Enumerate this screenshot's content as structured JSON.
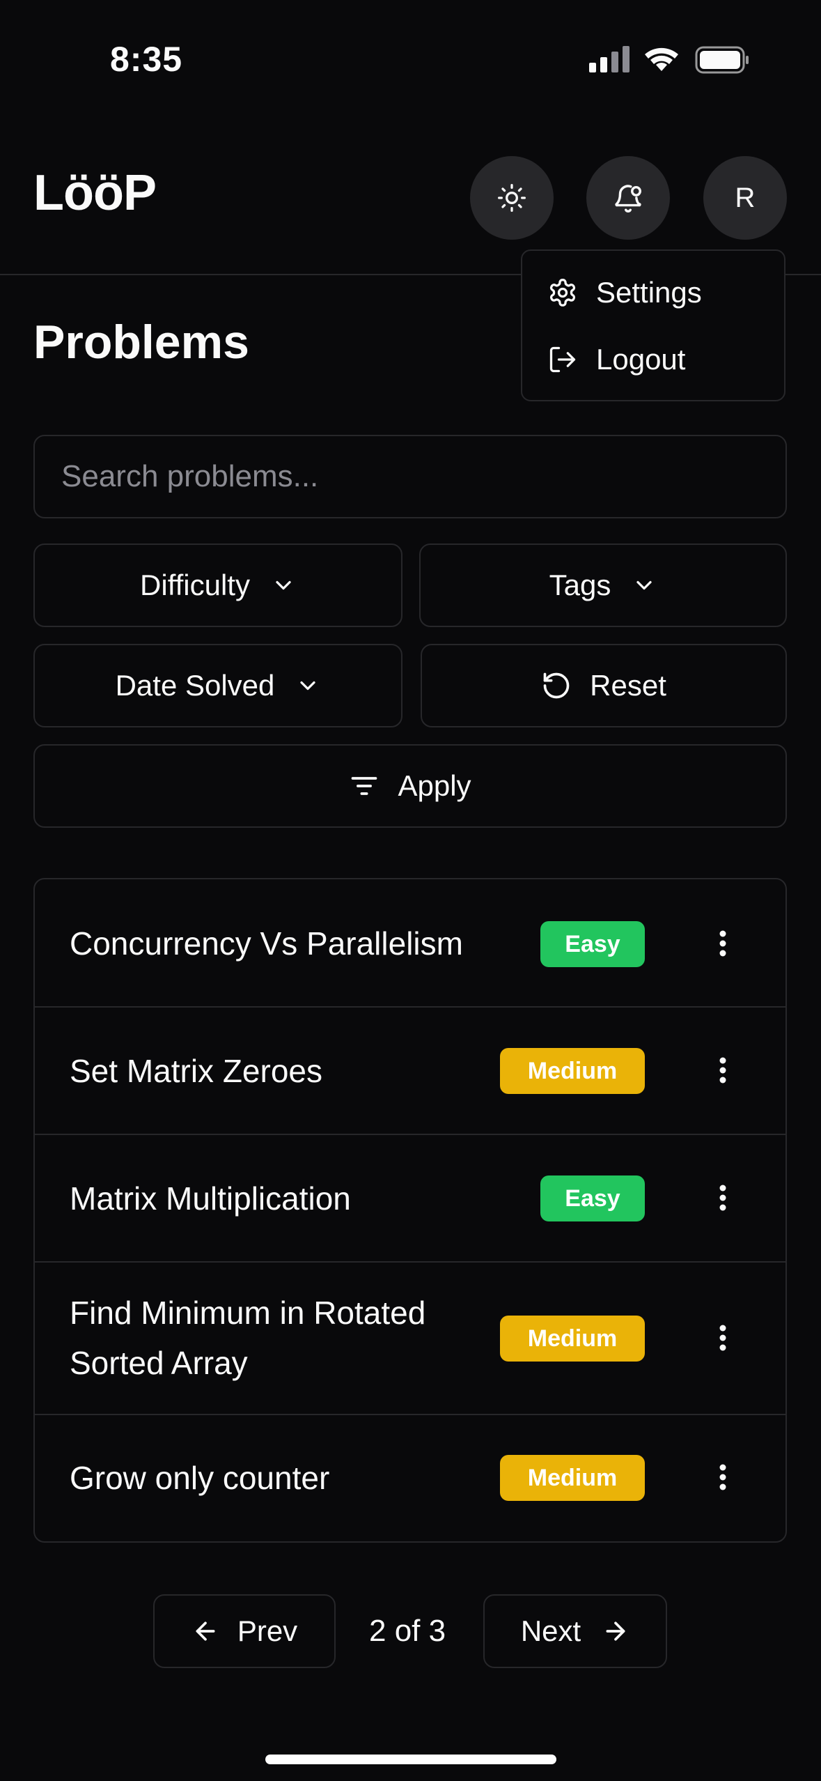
{
  "status_bar": {
    "time": "8:35"
  },
  "header": {
    "logo": "LööP",
    "avatar_initial": "R",
    "theme_icon": "sun-icon",
    "notification_icon": "bell-icon"
  },
  "user_menu": {
    "items": [
      {
        "label": "Settings",
        "icon": "gear-icon"
      },
      {
        "label": "Logout",
        "icon": "logout-icon"
      }
    ]
  },
  "page": {
    "title": "Problems"
  },
  "search": {
    "placeholder": "Search problems...",
    "value": ""
  },
  "filters": {
    "difficulty_label": "Difficulty",
    "tags_label": "Tags",
    "date_solved_label": "Date Solved",
    "reset_label": "Reset",
    "apply_label": "Apply"
  },
  "problems": [
    {
      "title": "Concurrency Vs Parallelism",
      "difficulty": "Easy"
    },
    {
      "title": "Set Matrix Zeroes",
      "difficulty": "Medium"
    },
    {
      "title": "Matrix Multiplication",
      "difficulty": "Easy"
    },
    {
      "title": "Find Minimum in Rotated Sorted Array",
      "difficulty": "Medium"
    },
    {
      "title": "Grow only counter",
      "difficulty": "Medium"
    }
  ],
  "pagination": {
    "prev_label": "Prev",
    "next_label": "Next",
    "indicator": "2 of 3"
  },
  "colors": {
    "background": "#09090b",
    "border": "#27272a",
    "easy": "#22c55e",
    "medium": "#eab308"
  }
}
